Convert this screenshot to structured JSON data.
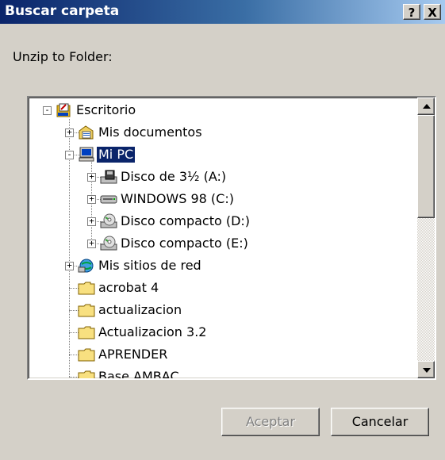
{
  "window": {
    "title": "Buscar carpeta",
    "help_label": "?",
    "close_label": "X"
  },
  "prompt": "Unzip to Folder:",
  "tree": {
    "items": [
      {
        "label": "Escritorio",
        "icon": "desktop-icon",
        "expander": "-"
      },
      {
        "label": "Mis documentos",
        "icon": "my-documents-icon",
        "expander": "+"
      },
      {
        "label": "Mi PC",
        "icon": "my-computer-icon",
        "expander": "-",
        "selected": true
      },
      {
        "label": "Disco de 3½ (A:)",
        "icon": "floppy-drive-icon",
        "expander": "+"
      },
      {
        "label": "WINDOWS 98 (C:)",
        "icon": "hard-drive-icon",
        "expander": "+"
      },
      {
        "label": "Disco compacto (D:)",
        "icon": "cd-drive-icon",
        "expander": "+"
      },
      {
        "label": "Disco compacto (E:)",
        "icon": "cd-drive-icon",
        "expander": "+"
      },
      {
        "label": "Mis sitios de red",
        "icon": "network-places-icon",
        "expander": "+"
      },
      {
        "label": "acrobat 4",
        "icon": "folder-icon"
      },
      {
        "label": "actualizacion",
        "icon": "folder-icon"
      },
      {
        "label": "Actualizacion 3.2",
        "icon": "folder-icon"
      },
      {
        "label": "APRENDER",
        "icon": "folder-icon"
      },
      {
        "label": "Base AMBAC",
        "icon": "folder-icon"
      }
    ]
  },
  "buttons": {
    "ok_label": "Aceptar",
    "cancel_label": "Cancelar"
  },
  "colors": {
    "title_bar_start": "#0a246a",
    "title_bar_end": "#a6caf0",
    "selection": "#0a246a",
    "face": "#d4d0c8"
  }
}
